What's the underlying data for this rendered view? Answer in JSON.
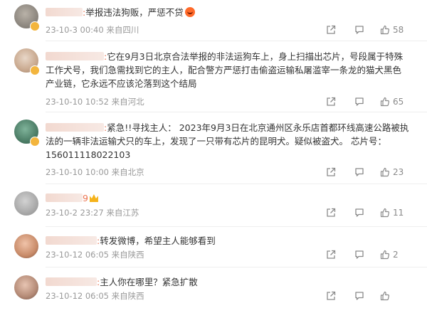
{
  "comments": [
    {
      "text": "举报违法狗贩，严惩不贷",
      "time": "23-10-3 00:40",
      "location": "来自四川",
      "likes": "58",
      "emoji": "angry-face"
    },
    {
      "text": "它在9月3日北京合法举报的非法运狗车上，身上扫描出芯片，号段属于特殊工作犬号，我们急需找到它的主人，配合警方严惩打击偷盗运输私屠滥宰一条龙的猫犬黑色产业链，它永远不应该沦落到这个结局",
      "time": "23-10-10 10:52",
      "location": "来自河北",
      "likes": "65"
    },
    {
      "text": "紧急!!寻找主人：  2023年9月3日在北京通州区永乐店首都环线高速公路被执法的一辆非法运输犬只的车上，发现了一只带有芯片的昆明犬。疑似被盗犬。  芯片号：156011118022103",
      "time": "23-10-10 10:00",
      "location": "来自北京",
      "likes": "23"
    },
    {
      "text": "",
      "name_fragment": "9",
      "time": "23-10-2 23:27",
      "location": "来自江苏",
      "likes": "11"
    },
    {
      "text": "转发微博，希望主人能够看到",
      "time": "23-10-12 06:05",
      "location": "来自陕西",
      "likes": "2"
    },
    {
      "text": "主人你在哪里？紧急扩散",
      "time": "23-10-12 06:05",
      "location": "来自陕西",
      "likes": ""
    }
  ],
  "icons": {
    "share": "share-icon",
    "reply": "comment-icon",
    "like": "thumbs-up-icon"
  },
  "colors": {
    "username": "#eb7350",
    "meta": "#999999",
    "badge": "#f3b53d"
  }
}
